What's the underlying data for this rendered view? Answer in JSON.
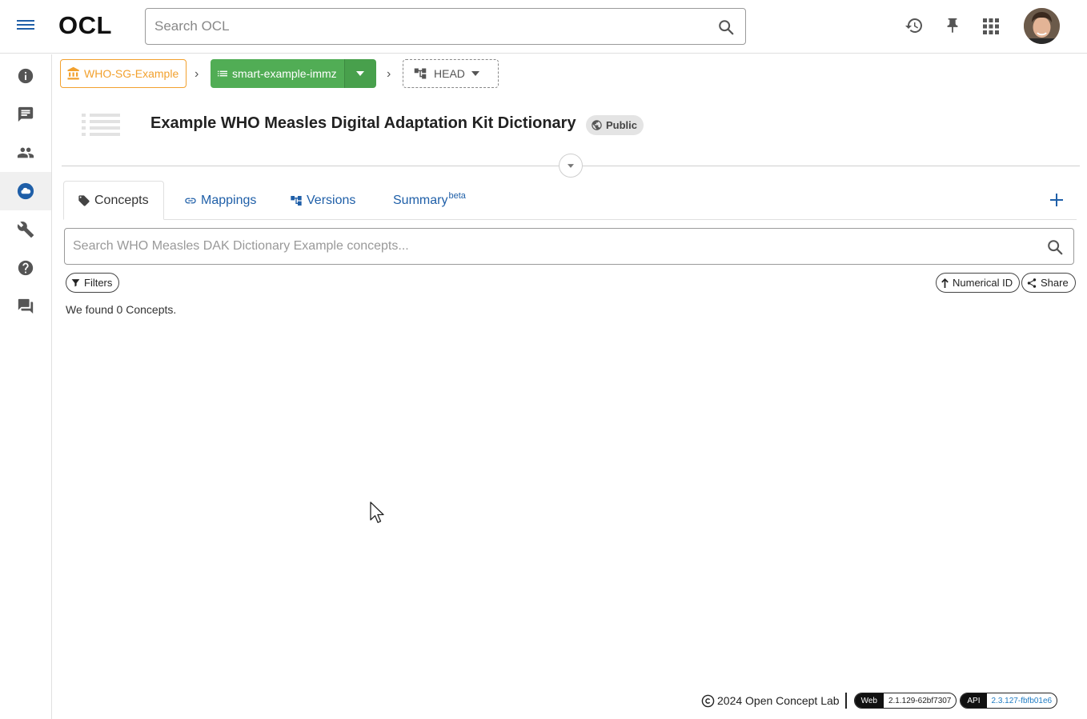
{
  "app": {
    "logo": "OCL",
    "search_placeholder": "Search OCL"
  },
  "breadcrumb": {
    "org": "WHO-SG-Example",
    "source": "smart-example-immz",
    "version": "HEAD"
  },
  "header": {
    "title": "Example WHO Measles Digital Adaptation Kit Dictionary",
    "visibility": "Public"
  },
  "tabs": [
    {
      "label": "Concepts",
      "active": true
    },
    {
      "label": "Mappings",
      "active": false
    },
    {
      "label": "Versions",
      "active": false
    },
    {
      "label": "Summary",
      "sup": "beta",
      "active": false
    }
  ],
  "concepts": {
    "search_placeholder": "Search WHO Measles DAK Dictionary Example concepts...",
    "filters_label": "Filters",
    "sort_label": "Numerical ID",
    "share_label": "Share",
    "result_text": "We found 0 Concepts."
  },
  "footer": {
    "copyright": "2024 Open Concept Lab",
    "web_label": "Web",
    "web_version": "2.1.129-62bf7307",
    "api_label": "API",
    "api_version": "2.3.127-fbfb01e6"
  },
  "colors": {
    "primary": "#1f5fa8",
    "org": "#f2a12e",
    "source": "#51ad55"
  }
}
